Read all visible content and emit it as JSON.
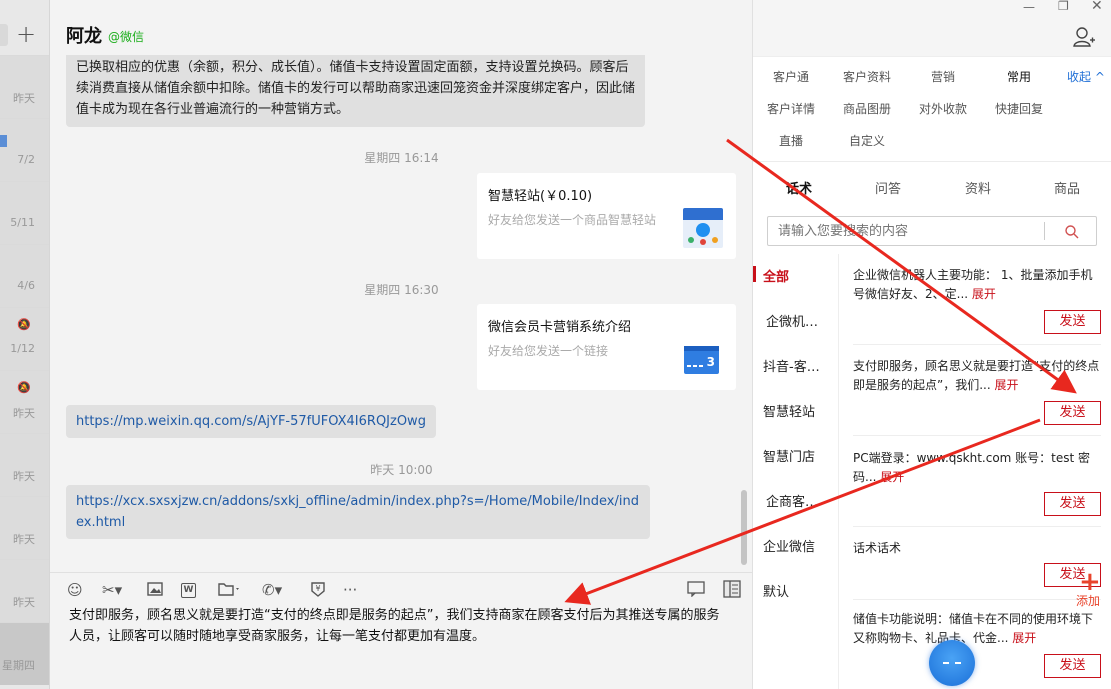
{
  "sidebar": {
    "plus_label": "+",
    "conversations": [
      {
        "date": "昨天",
        "mute": false
      },
      {
        "date": "7/2",
        "mute": false
      },
      {
        "date": "5/11",
        "mute": false
      },
      {
        "date": "4/6",
        "mute": false
      },
      {
        "date": "1/12",
        "mute": true
      },
      {
        "date": "昨天",
        "mute": true
      },
      {
        "date": "昨天",
        "mute": false
      },
      {
        "date": "昨天",
        "mute": false
      },
      {
        "date": "昨天",
        "mute": false
      },
      {
        "date": "星期四",
        "mute": false
      }
    ]
  },
  "chat": {
    "title": "阿龙",
    "source": "@微信",
    "messages": {
      "text1": "已换取相应的优惠（余额，积分、成长值）。储值卡支持设置固定面额，支持设置兑换码。顾客后续消费直接从储值余额中扣除。储值卡的发行可以帮助商家迅速回笼资金并深度绑定客户，因此储值卡成为现在各行业普遍流行的一种营销方式。",
      "time1": "星期四 16:14",
      "card1_title": "智慧轻站(￥0.10)",
      "card1_desc": "好友给您发送一个商品智慧轻站",
      "time2": "星期四 16:30",
      "card2_title": "微信会员卡营销系统介绍",
      "card2_desc": "好友给您发送一个链接",
      "card2_thumb_num": "3",
      "link1": "https://mp.weixin.qq.com/s/AjYF-57fUFOX4I6RQJzOwg",
      "time3": "昨天 10:00",
      "link2": "https://xcx.sxsxjzw.cn/addons/sxkj_offline/admin/index.php?s=/Home/Mobile/Index/index.html"
    },
    "input_text": "支付即服务，顾名思义就是要打造“支付的终点即是服务的起点”，我们支持商家在顾客支付后为其推送专属的服务人员，让顾客可以随时随地享受商家服务，让每一笔支付都更加有温度。",
    "toolbar_icons": [
      "emoji-icon",
      "scissors-icon",
      "image-icon",
      "word-icon",
      "folder-icon",
      "phone-icon",
      "money-icon",
      "more-icon"
    ]
  },
  "panel": {
    "tabs_row1": [
      "客户通",
      "客户资料",
      "营销",
      "常用"
    ],
    "collapse_label": "收起",
    "tabs_row2": [
      "客户详情",
      "商品图册",
      "对外收款",
      "快捷回复"
    ],
    "tabs_row3": [
      "直播",
      "自定义"
    ],
    "subtabs": [
      "话术",
      "问答",
      "资料",
      "商品"
    ],
    "search_placeholder": "请输入您要搜索的内容",
    "categories": [
      "全部",
      "企微机…",
      "抖音-客…",
      "智慧轻站",
      "智慧门店",
      "企商客…",
      "企业微信",
      "默认"
    ],
    "items": [
      {
        "text": "企业微信机器人主要功能： 1、批量添加手机号微信好友、2、定...",
        "expand": "展开",
        "send": "发送"
      },
      {
        "text": "支付即服务，顾名思义就是要打造“支付的终点即是服务的起点”，我们...",
        "expand": "展开",
        "send": "发送"
      },
      {
        "text": "PC端登录：www.qskht.com 账号：test 密码...",
        "expand": "展开",
        "send": "发送"
      },
      {
        "text": "话术话术",
        "expand": "",
        "send": "发送"
      },
      {
        "text": "储值卡功能说明：储值卡在不同的使用环境下又称购物卡、礼品卡、代金...",
        "expand": "展开",
        "send": "发送"
      }
    ],
    "fab_plus": "+",
    "fab_label": "添加"
  },
  "colors": {
    "accent_red": "#c8101a",
    "link_blue": "#1f5aa6",
    "wechat_green": "#1aad19",
    "arrow_red": "#e8281f"
  }
}
